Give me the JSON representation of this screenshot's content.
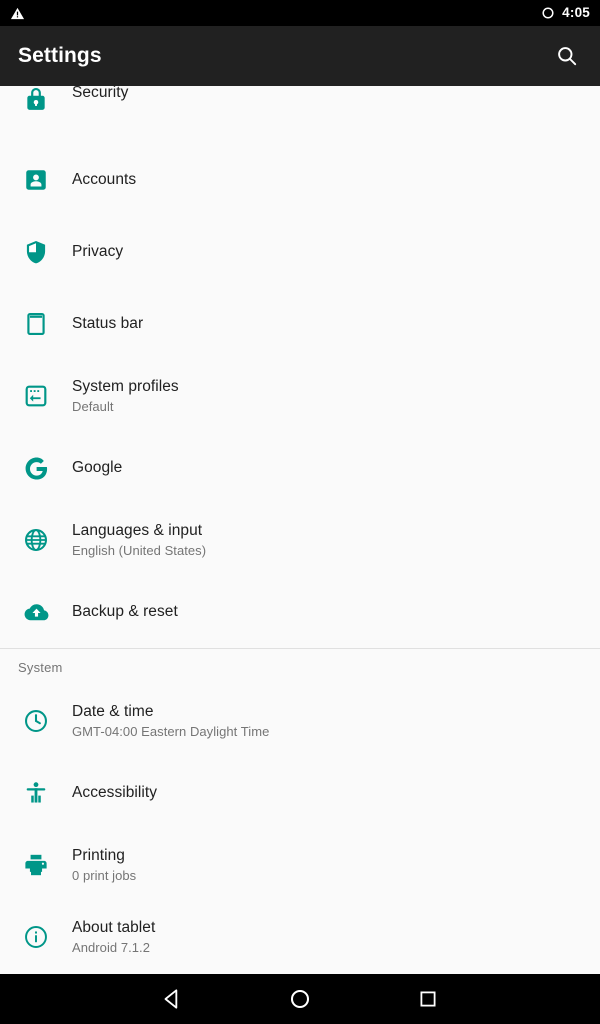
{
  "status_bar": {
    "notification_icon": "warning-triangle-icon",
    "dnd_icon": "circle-ring-icon",
    "time": "4:05"
  },
  "action_bar": {
    "title": "Settings",
    "search_icon": "search-icon"
  },
  "list": [
    {
      "icon": "lock-icon",
      "title": "Security",
      "subtitle": "",
      "clipped": true
    },
    {
      "icon": "account-box-icon",
      "title": "Accounts",
      "subtitle": ""
    },
    {
      "icon": "shield-icon",
      "title": "Privacy",
      "subtitle": ""
    },
    {
      "icon": "status-bar-icon",
      "title": "Status bar",
      "subtitle": ""
    },
    {
      "icon": "system-profiles-icon",
      "title": "System profiles",
      "subtitle": "Default"
    },
    {
      "icon": "google-g-icon",
      "title": "Google",
      "subtitle": ""
    },
    {
      "icon": "globe-icon",
      "title": "Languages & input",
      "subtitle": "English (United States)"
    },
    {
      "icon": "cloud-upload-icon",
      "title": "Backup & reset",
      "subtitle": ""
    }
  ],
  "section": {
    "system_label": "System",
    "items": [
      {
        "icon": "clock-icon",
        "title": "Date & time",
        "subtitle": "GMT-04:00 Eastern Daylight Time"
      },
      {
        "icon": "accessibility-icon",
        "title": "Accessibility",
        "subtitle": ""
      },
      {
        "icon": "printer-icon",
        "title": "Printing",
        "subtitle": "0 print jobs"
      },
      {
        "icon": "info-icon",
        "title": "About tablet",
        "subtitle": "Android 7.1.2"
      }
    ]
  },
  "nav_bar": {
    "back": "back-triangle-icon",
    "home": "home-circle-icon",
    "recents": "recents-square-icon"
  },
  "colors": {
    "accent": "#009688",
    "action_bar": "#212121",
    "background": "#fafafa",
    "primary_text": "#212121",
    "secondary_text": "#757575",
    "divider": "#e0e0e0"
  }
}
